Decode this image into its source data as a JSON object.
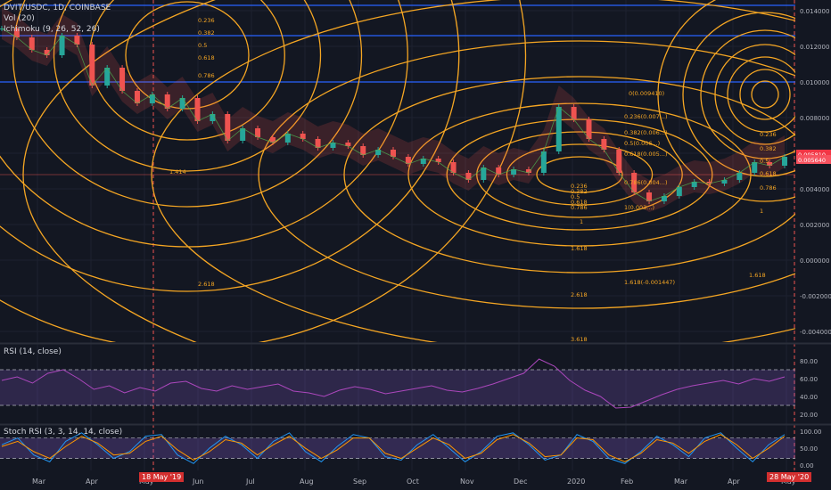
{
  "header": {
    "symbol": "DVIT/USDC, 1D, COINBASE",
    "vol": "Vol (20)",
    "ichimoku": "Ichimoku (9, 26, 52, 26)"
  },
  "chart_data": [
    {
      "type": "candlestick",
      "pane": "price",
      "x_ticks": [
        "Mar",
        "Apr",
        "May",
        "Jun",
        "Jul",
        "Aug",
        "Sep",
        "Oct",
        "Nov",
        "Dec",
        "2020",
        "Feb",
        "Mar",
        "Apr",
        "May"
      ],
      "y_ticks": [
        "0.014000",
        "0.012000",
        "0.010000",
        "0.008000",
        "0.006000",
        "0.004000",
        "0.002000",
        "0.000000",
        "-0.002000",
        "-0.004000"
      ],
      "ylim": [
        -0.0045,
        0.0145
      ],
      "fib_labels": [
        {
          "text": "0.236",
          "price": 0.0135
        },
        {
          "text": "0.382",
          "price": 0.0128
        },
        {
          "text": "0.5",
          "price": 0.0121
        },
        {
          "text": "0.618",
          "price": 0.0114
        },
        {
          "text": "0.786",
          "price": 0.0104
        },
        {
          "text": "1.414",
          "price": 0.005
        },
        {
          "text": "2.618",
          "price": -0.0013
        },
        {
          "text": "0(0.009410)",
          "price": 0.0094
        },
        {
          "text": "0.236(0.007...)",
          "price": 0.0081
        },
        {
          "text": "0.382(0.006...)",
          "price": 0.0072
        },
        {
          "text": "0.5(0.006...)",
          "price": 0.0066
        },
        {
          "text": "0.618(0.005...)",
          "price": 0.006
        },
        {
          "text": "0.786(0.004...)",
          "price": 0.0044
        },
        {
          "text": "1(0.003...)",
          "price": 0.003
        },
        {
          "text": "0.236",
          "price": 0.0042
        },
        {
          "text": "0.382",
          "price": 0.0039
        },
        {
          "text": "0.5",
          "price": 0.0036
        },
        {
          "text": "0.618",
          "price": 0.0033
        },
        {
          "text": "0.786",
          "price": 0.003
        },
        {
          "text": "1",
          "price": 0.0022
        },
        {
          "text": "1.618",
          "price": 0.0007
        },
        {
          "text": "2.618",
          "price": -0.0019
        },
        {
          "text": "3.618",
          "price": -0.0044
        },
        {
          "text": "1.618(-0.001447)",
          "price": -0.0012
        },
        {
          "text": "1.618",
          "price": -0.0008
        },
        {
          "text": "0.236",
          "price": 0.0071
        },
        {
          "text": "0.382",
          "price": 0.0063
        },
        {
          "text": "0.5",
          "price": 0.0056
        },
        {
          "text": "0.618",
          "price": 0.0049
        },
        {
          "text": "0.786",
          "price": 0.0041
        },
        {
          "text": "1",
          "price": 0.0028
        }
      ],
      "h_lines": [
        0.0143,
        0.0126,
        0.01,
        0.0048
      ],
      "price_tags": [
        {
          "text": "0.005810",
          "price": 0.00595,
          "color": "#f23645"
        },
        {
          "text": "0.005640",
          "price": 0.00565,
          "color": "#f7525f"
        }
      ],
      "date_flags": [
        {
          "text": "18 May '19",
          "position": "left"
        },
        {
          "text": "28 May '20",
          "position": "right"
        }
      ],
      "series": [
        {
          "name": "DVIT/USDC",
          "values": [
            0.013,
            0.0125,
            0.0118,
            0.0115,
            0.0126,
            0.0121,
            0.0098,
            0.0108,
            0.0095,
            0.0088,
            0.0093,
            0.0085,
            0.0091,
            0.0078,
            0.0082,
            0.0067,
            0.0074,
            0.0069,
            0.0066,
            0.0071,
            0.0068,
            0.0063,
            0.0066,
            0.0064,
            0.0059,
            0.0062,
            0.0058,
            0.0054,
            0.0057,
            0.0055,
            0.0049,
            0.0045,
            0.0052,
            0.0048,
            0.0051,
            0.0049,
            0.0061,
            0.0086,
            0.0079,
            0.0068,
            0.0062,
            0.0049,
            0.0038,
            0.0033,
            0.0036,
            0.0041,
            0.0044,
            0.0043,
            0.0045,
            0.0049,
            0.0055,
            0.0053,
            0.0058
          ]
        }
      ]
    },
    {
      "type": "line",
      "pane": "rsi",
      "title": "RSI (14, close)",
      "y_ticks": [
        "80.00",
        "60.00",
        "40.00",
        "20.00"
      ],
      "ylim": [
        15,
        90
      ],
      "bands": [
        70,
        30
      ],
      "series": [
        {
          "name": "RSI",
          "values": [
            58,
            62,
            55,
            66,
            70,
            60,
            48,
            52,
            44,
            50,
            46,
            55,
            57,
            49,
            46,
            52,
            48,
            51,
            54,
            46,
            44,
            40,
            47,
            51,
            48,
            43,
            46,
            49,
            52,
            47,
            45,
            49,
            54,
            60,
            66,
            82,
            74,
            58,
            47,
            40,
            27,
            28,
            35,
            42,
            48,
            52,
            55,
            58,
            54,
            60,
            57,
            62
          ]
        }
      ]
    },
    {
      "type": "line",
      "pane": "stoch",
      "title": "Stoch RSI (3, 3, 14, 14, close)",
      "y_ticks": [
        "100.00",
        "50.00",
        "0.00"
      ],
      "ylim": [
        -10,
        105
      ],
      "bands": [
        80,
        20
      ],
      "series": [
        {
          "name": "%K",
          "values": [
            60,
            80,
            30,
            10,
            70,
            95,
            60,
            20,
            40,
            85,
            90,
            30,
            5,
            50,
            85,
            60,
            20,
            70,
            95,
            40,
            10,
            55,
            90,
            80,
            25,
            15,
            60,
            90,
            50,
            10,
            40,
            85,
            95,
            60,
            15,
            30,
            90,
            70,
            20,
            5,
            40,
            85,
            60,
            25,
            80,
            95,
            50,
            10,
            60,
            90
          ]
        },
        {
          "name": "%D",
          "values": [
            55,
            70,
            40,
            20,
            55,
            85,
            65,
            30,
            35,
            70,
            85,
            45,
            15,
            40,
            75,
            65,
            30,
            60,
            85,
            50,
            20,
            45,
            80,
            80,
            35,
            20,
            50,
            80,
            60,
            20,
            35,
            75,
            90,
            65,
            25,
            30,
            80,
            75,
            30,
            10,
            35,
            75,
            65,
            35,
            70,
            90,
            60,
            20,
            50,
            85
          ]
        }
      ]
    }
  ]
}
